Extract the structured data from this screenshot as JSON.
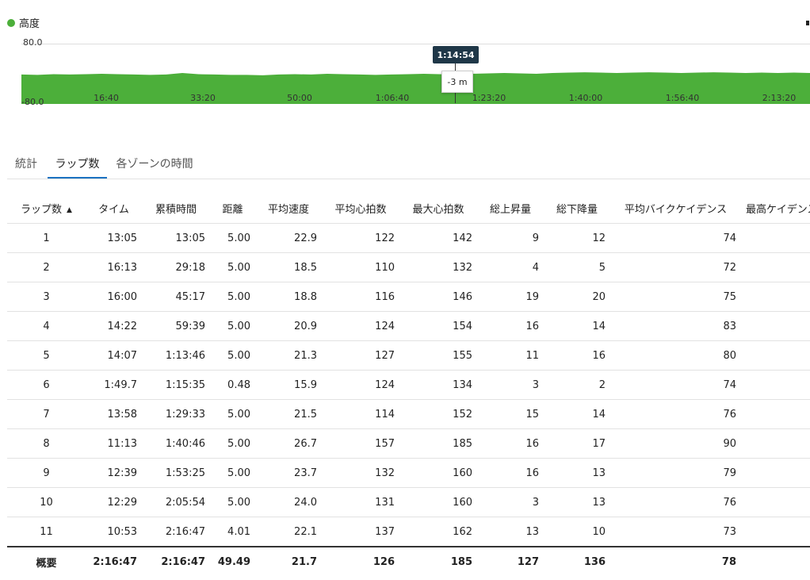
{
  "chart": {
    "legend_label": "高度",
    "series_color": "#4caf3a",
    "y_top_label": "80.0",
    "y_bottom_label": "-80.0",
    "x_ticks": [
      "16:40",
      "33:20",
      "50:00",
      "1:06:40",
      "1:23:20",
      "1:40:00",
      "1:56:40",
      "2:13:20"
    ],
    "cursor_time": "1:14:54",
    "cursor_value": "-3 m"
  },
  "chart_data": {
    "type": "area",
    "series": [
      {
        "name": "高度",
        "values": [
          -3,
          -4,
          -2,
          -3,
          -2,
          -1,
          -2,
          -3,
          -4,
          -3,
          1,
          -2,
          -3,
          -4,
          -4,
          -5,
          -3,
          -2,
          -3,
          -1,
          -2,
          -3,
          -4,
          -3,
          -2,
          -1,
          -2,
          -3,
          -1,
          0,
          1,
          0,
          -1,
          1,
          2,
          3,
          2,
          1,
          2,
          3,
          2,
          1,
          2,
          3,
          2,
          1,
          2,
          1,
          2,
          1
        ]
      }
    ],
    "ylim": [
      -80,
      80
    ],
    "xlim": [
      0,
      8207
    ]
  },
  "tabs": [
    {
      "label": "統計",
      "active": false
    },
    {
      "label": "ラップ数",
      "active": true
    },
    {
      "label": "各ゾーンの時間",
      "active": false
    }
  ],
  "table": {
    "columns": [
      "ラップ数",
      "タイム",
      "累積時間",
      "距離",
      "平均速度",
      "平均心拍数",
      "最大心拍数",
      "総上昇量",
      "総下降量",
      "平均バイクケイデンス",
      "最高ケイデンス"
    ],
    "sort_icon": "▲",
    "rows": [
      [
        "1",
        "13:05",
        "13:05",
        "5.00",
        "22.9",
        "122",
        "142",
        "9",
        "12",
        "74"
      ],
      [
        "2",
        "16:13",
        "29:18",
        "5.00",
        "18.5",
        "110",
        "132",
        "4",
        "5",
        "72"
      ],
      [
        "3",
        "16:00",
        "45:17",
        "5.00",
        "18.8",
        "116",
        "146",
        "19",
        "20",
        "75"
      ],
      [
        "4",
        "14:22",
        "59:39",
        "5.00",
        "20.9",
        "124",
        "154",
        "16",
        "14",
        "83"
      ],
      [
        "5",
        "14:07",
        "1:13:46",
        "5.00",
        "21.3",
        "127",
        "155",
        "11",
        "16",
        "80"
      ],
      [
        "6",
        "1:49.7",
        "1:15:35",
        "0.48",
        "15.9",
        "124",
        "134",
        "3",
        "2",
        "74"
      ],
      [
        "7",
        "13:58",
        "1:29:33",
        "5.00",
        "21.5",
        "114",
        "152",
        "15",
        "14",
        "76"
      ],
      [
        "8",
        "11:13",
        "1:40:46",
        "5.00",
        "26.7",
        "157",
        "185",
        "16",
        "17",
        "90"
      ],
      [
        "9",
        "12:39",
        "1:53:25",
        "5.00",
        "23.7",
        "132",
        "160",
        "16",
        "13",
        "79"
      ],
      [
        "10",
        "12:29",
        "2:05:54",
        "5.00",
        "24.0",
        "131",
        "160",
        "3",
        "13",
        "76"
      ],
      [
        "11",
        "10:53",
        "2:16:47",
        "4.01",
        "22.1",
        "137",
        "162",
        "13",
        "10",
        "73"
      ]
    ],
    "summary": [
      "概要",
      "2:16:47",
      "2:16:47",
      "49.49",
      "21.7",
      "126",
      "185",
      "127",
      "136",
      "78"
    ]
  }
}
